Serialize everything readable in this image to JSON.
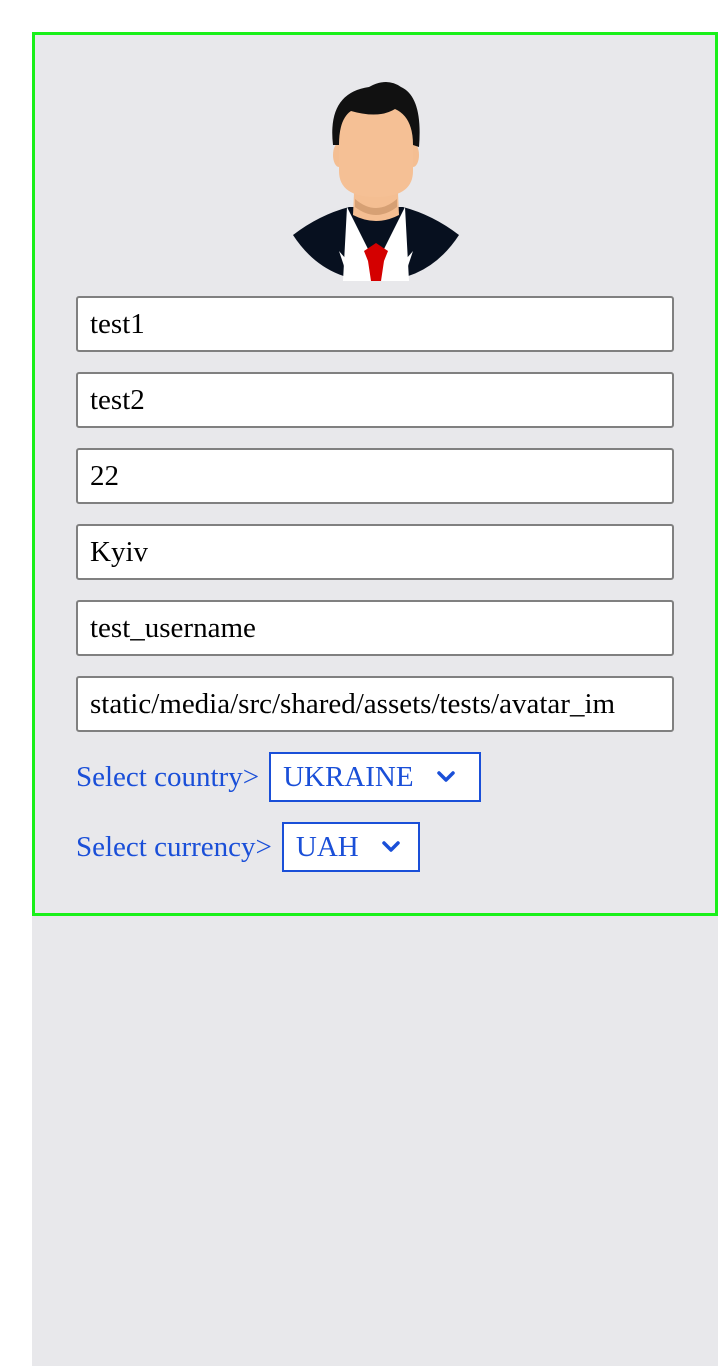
{
  "profile": {
    "avatar_icon": "businessman-avatar-icon",
    "first_name": "test1",
    "last_name": "test2",
    "age": "22",
    "city": "Kyiv",
    "username": "test_username",
    "avatar_path": "static/media/src/shared/assets/tests/avatar_im"
  },
  "country": {
    "label": "Select country>",
    "selected": "UKRAINE"
  },
  "currency": {
    "label": "Select currency>",
    "selected": "UAH"
  },
  "colors": {
    "card_border": "#19f019",
    "panel_bg": "#e8e8eb",
    "accent": "#1a4fd8"
  }
}
